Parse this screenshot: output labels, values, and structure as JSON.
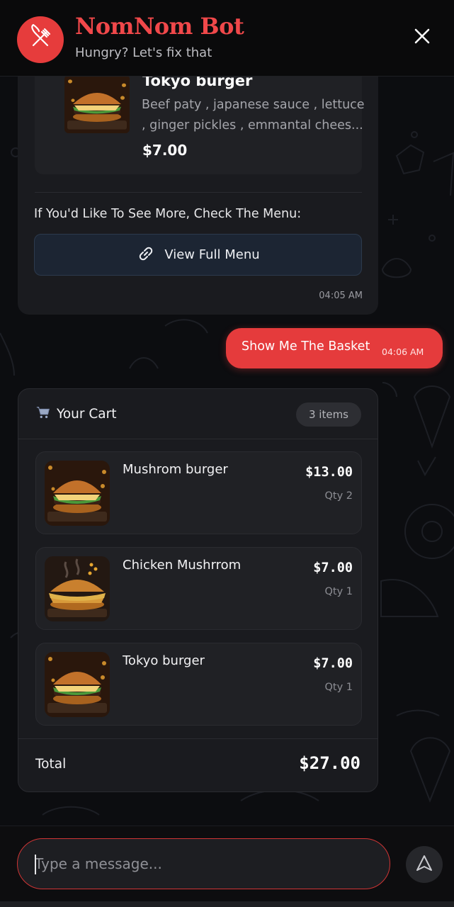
{
  "header": {
    "title": "NomNom Bot",
    "subtitle": "Hungry? Let's fix that",
    "logo_icon": "fork-knife-icon",
    "close_icon": "close-icon",
    "accent_color": "#e63c3c"
  },
  "bot_message": {
    "product": {
      "name": "Tokyo burger",
      "description_lines": [
        "Beef paty , japanese sauce , lettuce",
        ", ginger pickles , emmantal chees..."
      ],
      "price": "$7.00",
      "image": "burger-photo"
    },
    "see_more_text": "If You'd Like To See More, Check The Menu:",
    "menu_button_label": "View Full Menu",
    "menu_button_icon": "link-icon",
    "time": "04:05 AM"
  },
  "user_message": {
    "text": "Show Me The Basket",
    "time": "04:06 AM"
  },
  "cart": {
    "title": "Your Cart",
    "icon": "shopping-cart-icon",
    "count_label": "3 items",
    "items": [
      {
        "name": "Mushrom burger",
        "price": "$13.00",
        "qty": "Qty 2",
        "image": "burger-photo"
      },
      {
        "name": "Chicken Mushrrom",
        "price": "$7.00",
        "qty": "Qty 1",
        "image": "chicken-burger-photo"
      },
      {
        "name": "Tokyo burger",
        "price": "$7.00",
        "qty": "Qty 1",
        "image": "burger-photo"
      }
    ],
    "total_label": "Total",
    "total_value": "$27.00"
  },
  "composer": {
    "placeholder": "Type a message...",
    "value": "",
    "send_icon": "send-icon"
  }
}
